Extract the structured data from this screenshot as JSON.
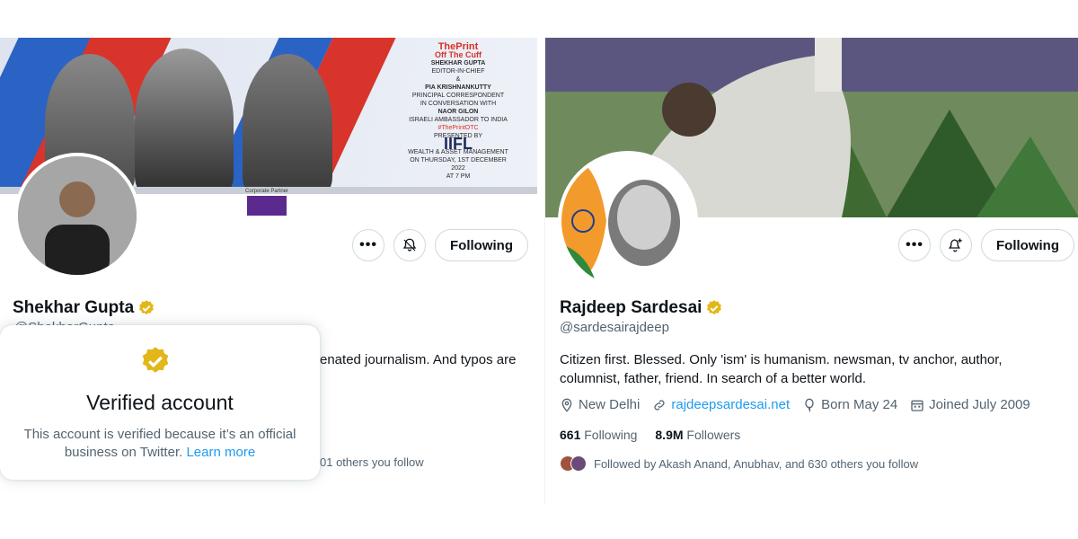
{
  "left": {
    "banner": {
      "brand": "ThePrint",
      "show": "Off The Cuff",
      "guest1": "SHEKHAR GUPTA",
      "guest1_role": "EDITOR-IN-CHIEF",
      "amp": "&",
      "guest2": "PIA KRISHNANKUTTY",
      "guest2_role": "PRINCIPAL CORRESPONDENT",
      "conversation": "IN CONVERSATION WITH",
      "guest3": "NAOR GILON",
      "guest3_role": "ISRAELI AMBASSADOR TO INDIA",
      "hashtag": "#ThePrintOTC",
      "presented": "PRESENTED BY",
      "sponsor": "IIFL",
      "sponsor_sub": "WEALTH & ASSET MANAGEMENT",
      "date": "ON THURSDAY, 1ST DECEMBER 2022",
      "time": "AT 7 PM",
      "corporate_partner": "Corporate Partner"
    },
    "follow_label": "Following",
    "display_name": "Shekhar Gupta",
    "handle": "@ShekharGupta",
    "bio": "enated journalism. And typos are",
    "followed_by": "01 others you follow"
  },
  "right": {
    "follow_label": "Following",
    "display_name": "Rajdeep Sardesai",
    "handle": "@sardesairajdeep",
    "bio": "Citizen first. Blessed. Only 'ism' is humanism. newsman, tv anchor, author, columnist, father, friend. In search of a better world.",
    "location": "New Delhi",
    "website": "rajdeepsardesai.net",
    "born": "Born May 24",
    "joined": "Joined July 2009",
    "following_count": "661",
    "following_label": "Following",
    "followers_count": "8.9M",
    "followers_label": "Followers",
    "followed_by": "Followed by Akash Anand, Anubhav, and 630 others you follow"
  },
  "popup": {
    "title": "Verified account",
    "text": "This account is verified because it’s an official business on Twitter.",
    "link": "Learn more"
  },
  "colors": {
    "accent": "#1d9bf0",
    "verified_gold": "#e2b719",
    "secondary_text": "#536471"
  },
  "icons": {
    "more": "more-icon",
    "notify": "bell-icon",
    "verified": "verified-badge-icon",
    "location": "location-pin-icon",
    "link": "link-icon",
    "birthday": "balloon-icon",
    "calendar": "calendar-icon"
  }
}
